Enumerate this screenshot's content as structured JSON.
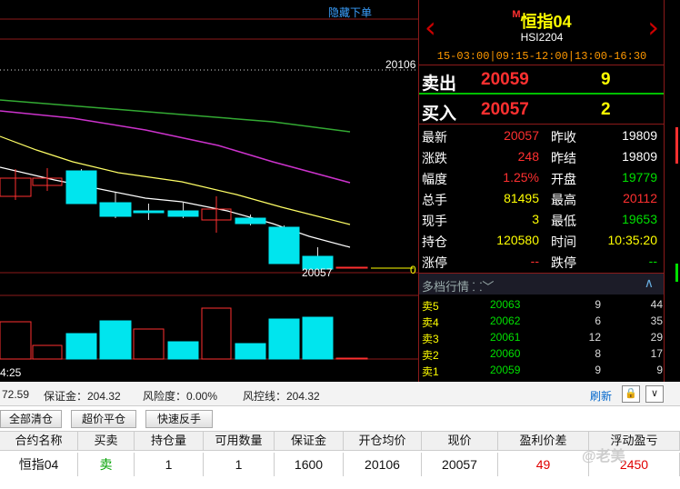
{
  "chart": {
    "hide_orders": "隐藏下单",
    "level_label": "20106",
    "last_label": "20057",
    "right_zero": "0",
    "time_label": "4:25",
    "colors": {
      "up": "#ff3030",
      "down": "#00e5ee",
      "ma_white": "#ffffff",
      "ma_yellow": "#ffff66",
      "ma_purple": "#cc33cc",
      "ma_green": "#33aa33",
      "grid": "#8b1a1a"
    }
  },
  "header": {
    "marker": "M",
    "name": "恒指04",
    "code": "HSI2204",
    "sessions": "15-03:00|09:15-12:00|13:00-16:30",
    "prev_icon": "chevron-left-icon",
    "next_icon": "chevron-right-icon"
  },
  "sell": {
    "label": "卖出",
    "price": "20059",
    "qty": "9"
  },
  "buy": {
    "label": "买入",
    "price": "20057",
    "qty": "2"
  },
  "quote": [
    {
      "l1": "最新",
      "v1": "20057",
      "c1": "red",
      "l2": "昨收",
      "v2": "19809",
      "c2": "white"
    },
    {
      "l1": "涨跌",
      "v1": "248",
      "c1": "red",
      "l2": "昨结",
      "v2": "19809",
      "c2": "white"
    },
    {
      "l1": "幅度",
      "v1": "1.25%",
      "c1": "red",
      "l2": "开盘",
      "v2": "19779",
      "c2": "green"
    },
    {
      "l1": "总手",
      "v1": "81495",
      "c1": "yellow",
      "l2": "最高",
      "v2": "20112",
      "c2": "red"
    },
    {
      "l1": "现手",
      "v1": "3",
      "c1": "yellow",
      "l2": "最低",
      "v2": "19653",
      "c2": "green"
    },
    {
      "l1": "持仓",
      "v1": "120580",
      "c1": "yellow",
      "l2": "时间",
      "v2": "10:35:20",
      "c2": "yellow"
    },
    {
      "l1": "涨停",
      "v1": "--",
      "c1": "red",
      "l2": "跌停",
      "v2": "--",
      "c2": "green"
    }
  ],
  "multi": {
    "title": "多档行情",
    "expand_icon": "double-chevron-down-icon",
    "collapse_icon": "chevron-up-icon"
  },
  "levels": [
    {
      "label": "卖5",
      "price": "20063",
      "qty": "9",
      "total": "44"
    },
    {
      "label": "卖4",
      "price": "20062",
      "qty": "6",
      "total": "35"
    },
    {
      "label": "卖3",
      "price": "20061",
      "qty": "12",
      "total": "29"
    },
    {
      "label": "卖2",
      "price": "20060",
      "qty": "8",
      "total": "17"
    },
    {
      "label": "卖1",
      "price": "20059",
      "qty": "9",
      "total": "9"
    }
  ],
  "status": {
    "balance_tail": "72.59",
    "margin": "保证金：204.32",
    "risk": "风险度：0.00%",
    "control": "风控线：204.32",
    "refresh": "刷新"
  },
  "buttons": {
    "close_all": "全部清仓",
    "super_close": "超价平仓",
    "reverse": "快速反手"
  },
  "table": {
    "headers": [
      "合约名称",
      "买卖",
      "持仓量",
      "可用数量",
      "保证金",
      "开仓均价",
      "现价",
      "盈利价差",
      "浮动盈亏"
    ],
    "row": [
      "恒指04",
      "卖",
      "1",
      "1",
      "1600",
      "20106",
      "20057",
      "49",
      "2450"
    ]
  },
  "watermark": "@老美"
}
